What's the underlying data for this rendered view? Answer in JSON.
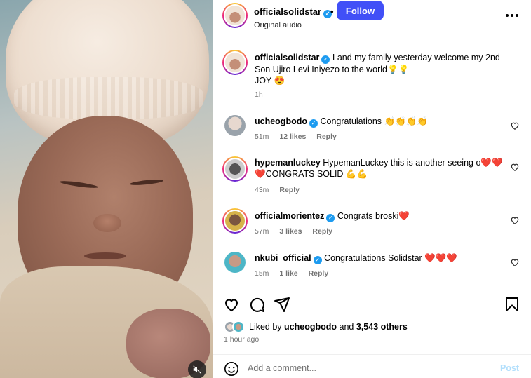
{
  "header": {
    "username": "officialsolidstar",
    "separator": "•",
    "follow_label": "Follow",
    "audio": "Original audio"
  },
  "caption": {
    "username": "officialsolidstar",
    "text": "I and my family yesterday welcome my 2nd Son Ujiro Levi Iniyezo to the world💡💡",
    "text2": "JOY 😍",
    "time": "1h"
  },
  "comments": [
    {
      "username": "ucheogbodo",
      "verified": true,
      "text": "Congratulations 👏👏👏👏",
      "time": "51m",
      "likes": "12 likes",
      "reply": "Reply"
    },
    {
      "username": "hypemanluckey",
      "verified": false,
      "text": "HypemanLuckey this is another seeing o❤️❤️",
      "text2": "❤️CONGRATS SOLID 💪💪",
      "time": "43m",
      "likes": "",
      "reply": "Reply"
    },
    {
      "username": "officialmorientez",
      "verified": true,
      "text": "Congrats broski❤️",
      "time": "57m",
      "likes": "3 likes",
      "reply": "Reply"
    },
    {
      "username": "nkubi_official",
      "verified": true,
      "text": "Congratulations Solidstar ❤️❤️❤️",
      "time": "15m",
      "likes": "1 like",
      "reply": "Reply"
    }
  ],
  "likes": {
    "prefix": "Liked by ",
    "user": "ucheogbodo",
    "and": " and ",
    "others": "3,543 others",
    "time_ago": "1 hour ago"
  },
  "composer": {
    "placeholder": "Add a comment...",
    "post_label": "Post"
  },
  "icons": {
    "verified": "verified-badge-icon",
    "more": "more-options-icon",
    "heart": "heart-icon",
    "comment": "comment-icon",
    "share": "share-icon",
    "save": "bookmark-icon",
    "emoji": "emoji-icon",
    "mute": "muted-speaker-icon"
  },
  "colors": {
    "follow": "#4150f7",
    "verified": "#1d9bf0",
    "muted_text": "#737373",
    "post_disabled": "#b2dffc"
  }
}
